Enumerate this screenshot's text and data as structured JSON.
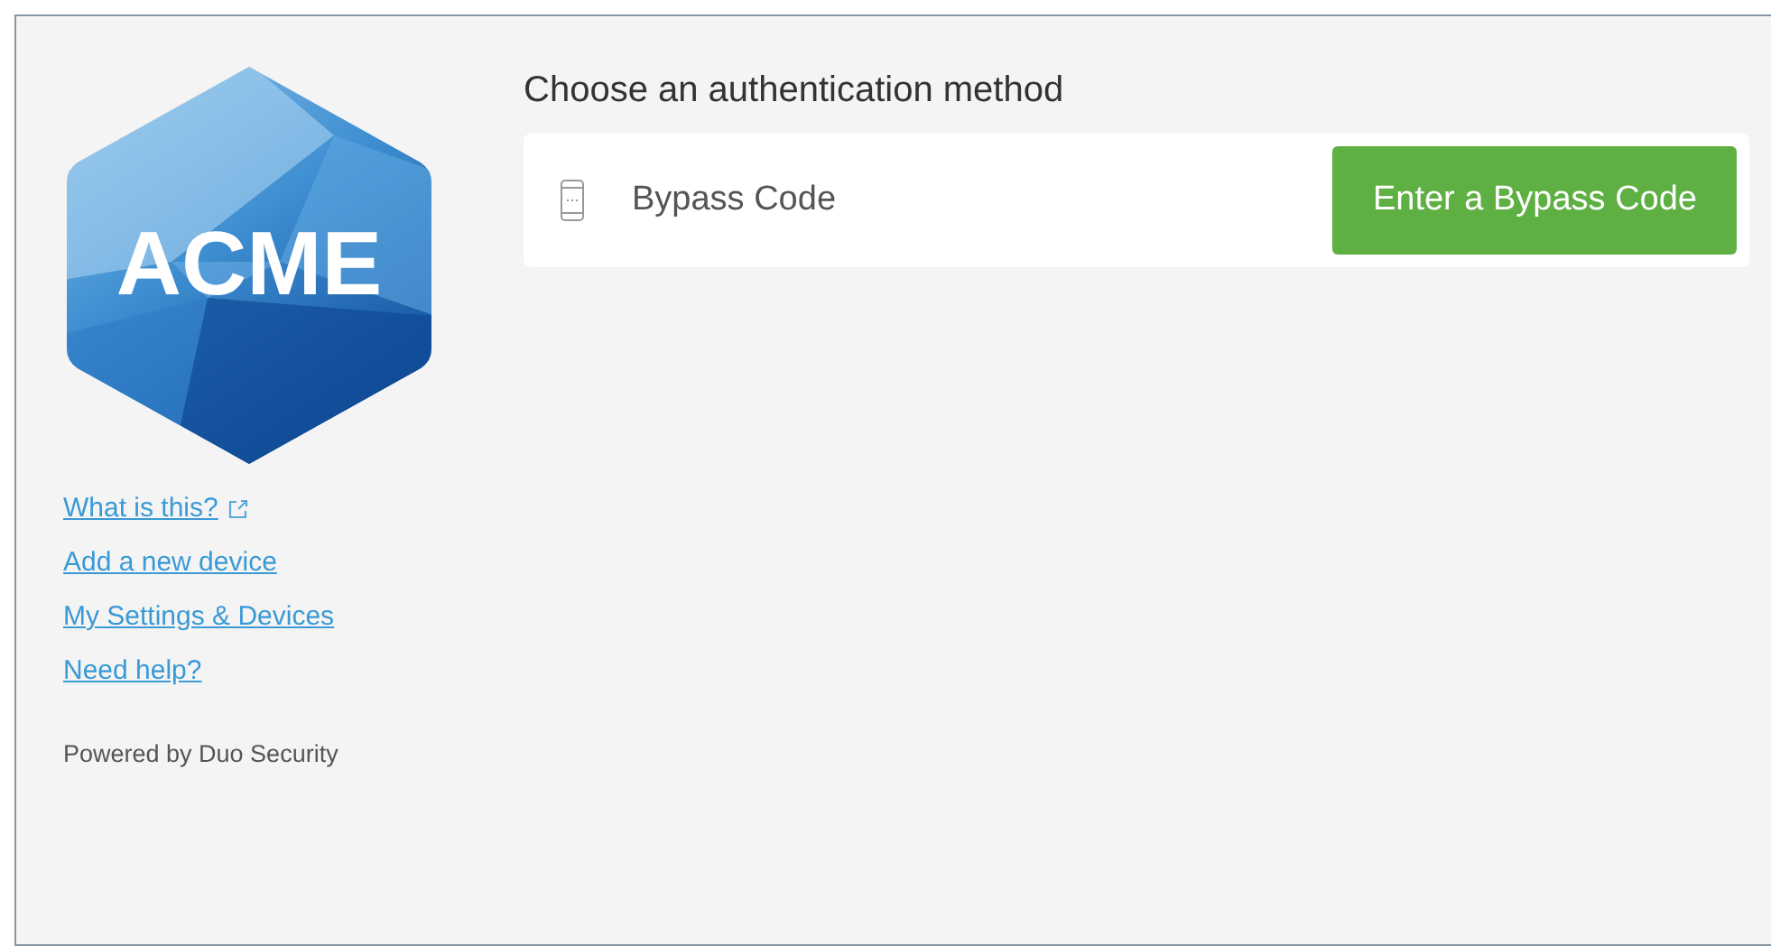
{
  "logo": {
    "text": "ACME"
  },
  "links": [
    {
      "label": "What is this?",
      "external": true
    },
    {
      "label": "Add a new device",
      "external": false
    },
    {
      "label": "My Settings & Devices",
      "external": false
    },
    {
      "label": "Need help?",
      "external": false
    }
  ],
  "powered_by": "Powered by Duo Security",
  "heading": "Choose an authentication method",
  "methods": [
    {
      "label": "Bypass Code",
      "button": "Enter a Bypass Code"
    }
  ]
}
